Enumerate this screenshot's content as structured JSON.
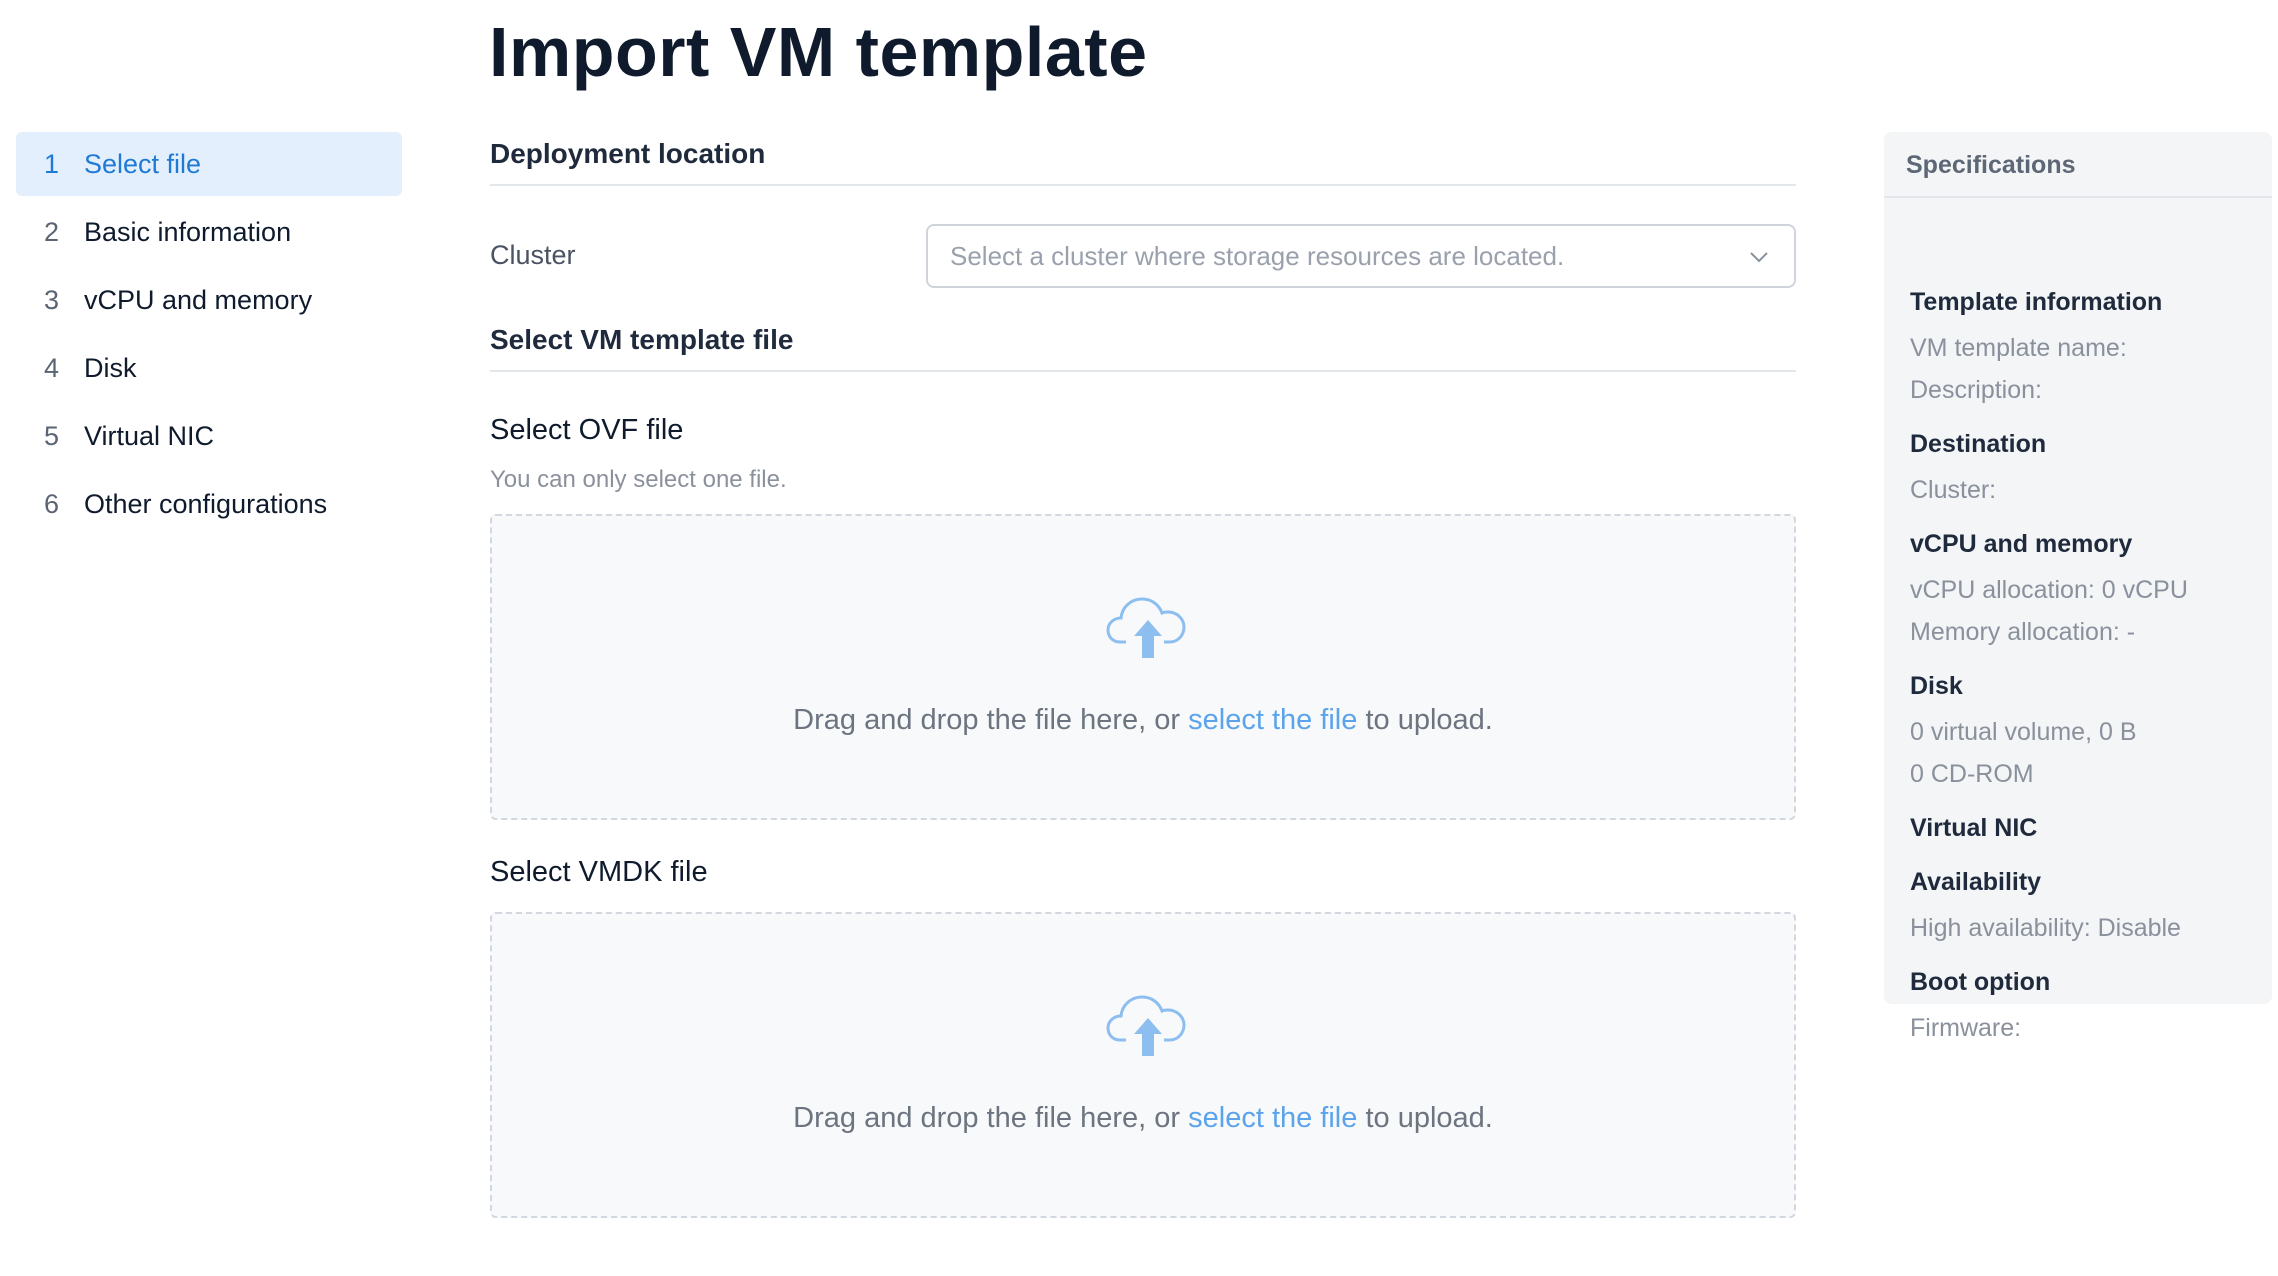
{
  "page": {
    "title": "Import VM template"
  },
  "steps": [
    {
      "num": "1",
      "label": "Select file",
      "active": true
    },
    {
      "num": "2",
      "label": "Basic information"
    },
    {
      "num": "3",
      "label": "vCPU and memory"
    },
    {
      "num": "4",
      "label": "Disk"
    },
    {
      "num": "5",
      "label": "Virtual NIC"
    },
    {
      "num": "6",
      "label": "Other configurations"
    }
  ],
  "deployment": {
    "heading": "Deployment location",
    "cluster_label": "Cluster",
    "cluster_placeholder": "Select a cluster where storage resources are located."
  },
  "template_file": {
    "heading": "Select VM template file",
    "ovf": {
      "title": "Select OVF file",
      "hint": "You can only select one file.",
      "drop_prefix": "Drag and drop the file here, or ",
      "drop_link": "select the file",
      "drop_suffix": " to upload."
    },
    "vmdk": {
      "title": "Select VMDK file",
      "drop_prefix": "Drag and drop the file here, or ",
      "drop_link": "select the file",
      "drop_suffix": " to upload."
    }
  },
  "specs": {
    "title": "Specifications",
    "template_info": "Template information",
    "vm_template_name": "VM template name:",
    "description": "Description:",
    "destination": "Destination",
    "cluster": "Cluster:",
    "vcpu_memory": "vCPU and memory",
    "vcpu_allocation": "vCPU allocation: 0 vCPU",
    "memory_allocation": "Memory allocation: -",
    "disk": "Disk",
    "virtual_volume": "0 virtual volume, 0 B",
    "cd_rom": "0 CD-ROM",
    "virtual_nic": "Virtual NIC",
    "availability": "Availability",
    "high_availability": "High availability: Disable",
    "boot_option": "Boot option",
    "firmware": "Firmware:"
  },
  "colors": {
    "accent": "#1f7ad6",
    "link": "#5ba3ea",
    "active_step_bg": "#e3effd",
    "icon_cloud": "#8dbef0"
  }
}
